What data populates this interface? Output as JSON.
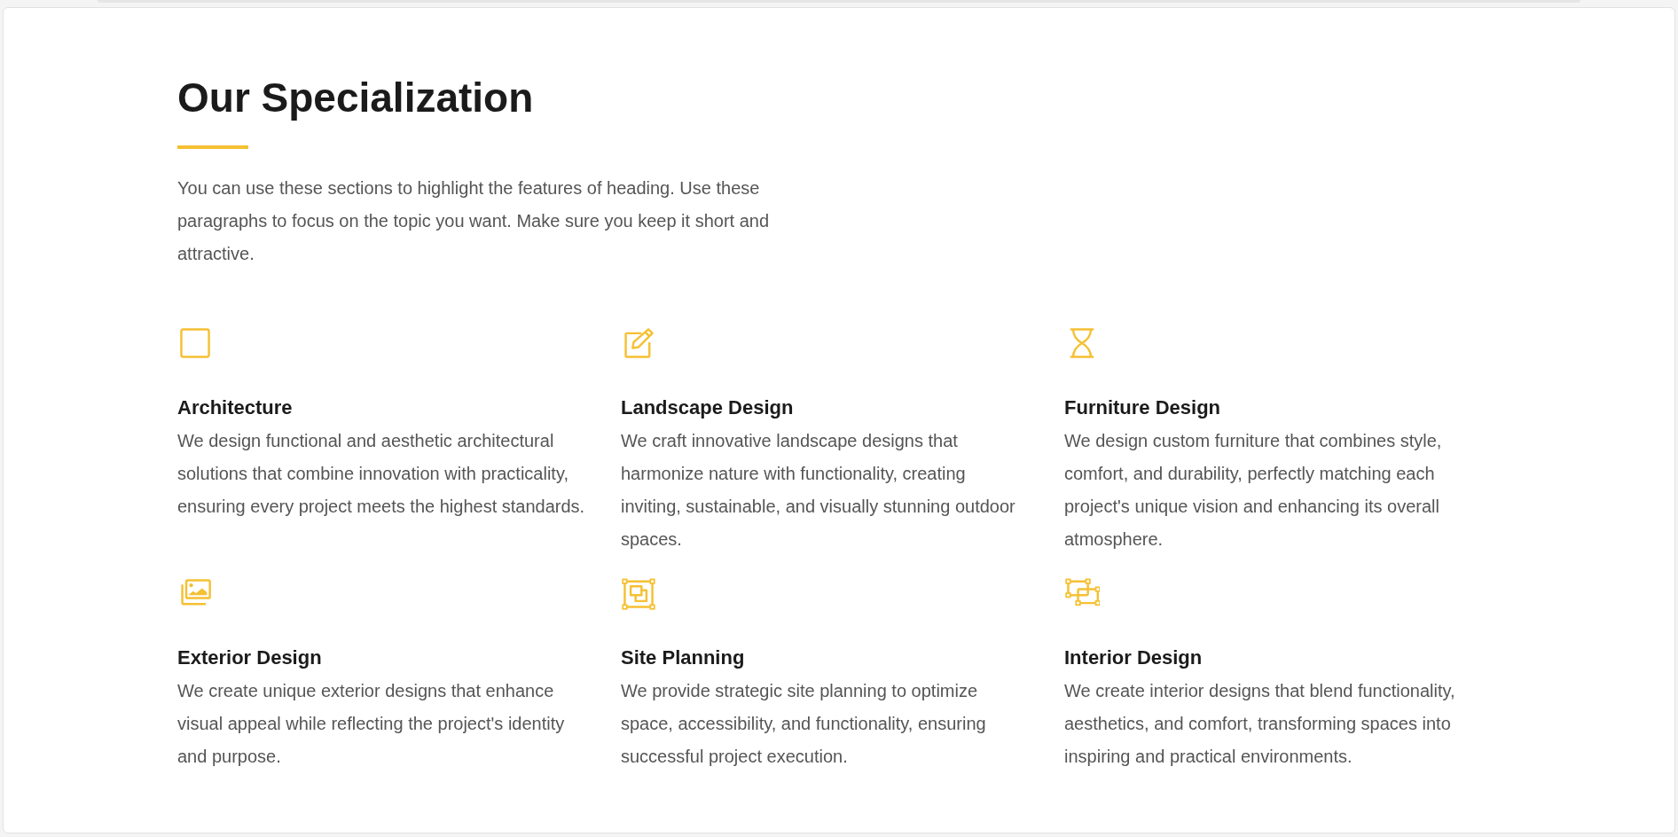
{
  "section": {
    "title": "Our Specialization",
    "intro": "You can use these sections to highlight the features of heading. Use these paragraphs to focus on the topic you want. Make sure you keep it short and attractive."
  },
  "services": [
    {
      "title": "Architecture",
      "text": "We design functional and aesthetic architectural solutions that combine innovation with practicality, ensuring every project meets the highest standards."
    },
    {
      "title": "Landscape Design",
      "text": "We craft innovative landscape designs that harmonize nature with functionality, creating inviting, sustainable, and visually stunning outdoor spaces."
    },
    {
      "title": "Furniture Design",
      "text": "We design custom furniture that combines style, comfort, and durability, perfectly matching each project's unique vision and enhancing its overall atmosphere."
    },
    {
      "title": "Exterior Design",
      "text": "We create unique exterior designs that enhance visual appeal while reflecting the project's identity and purpose."
    },
    {
      "title": "Site Planning",
      "text": "We provide strategic site planning to optimize space, accessibility, and functionality, ensuring successful project execution."
    },
    {
      "title": "Interior Design",
      "text": "We create interior designs that blend functionality, aesthetics, and comfort, transforming spaces into inspiring and practical environments."
    }
  ]
}
